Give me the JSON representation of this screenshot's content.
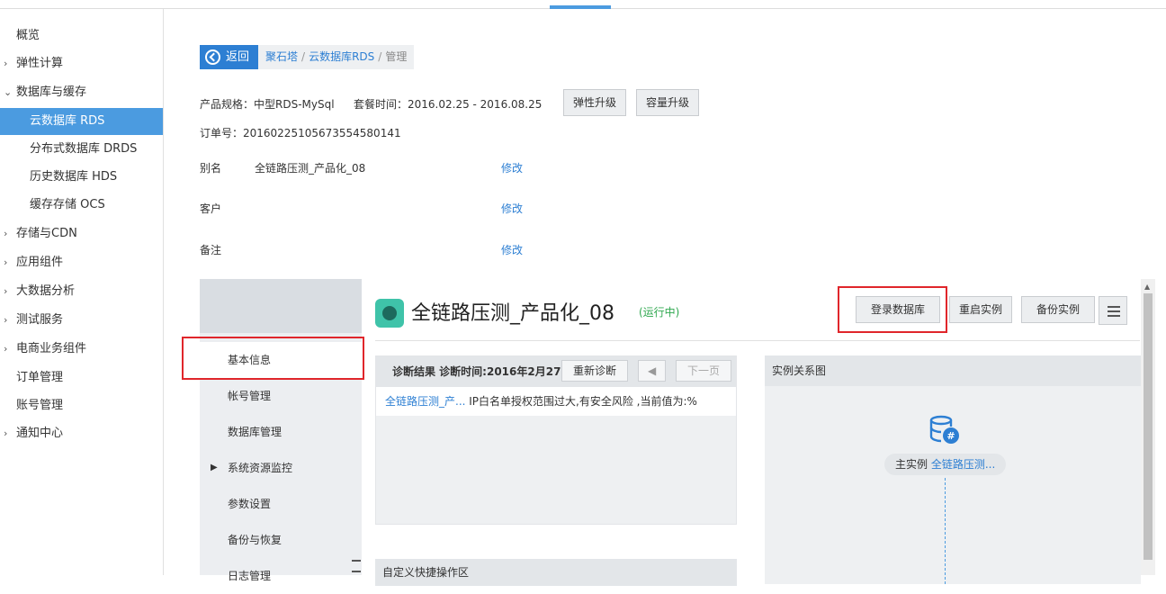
{
  "sidebar": {
    "items": [
      {
        "label": "概览"
      },
      {
        "label": "弹性计算",
        "caret": "›"
      },
      {
        "label": "数据库与缓存",
        "caret": "⌄"
      },
      {
        "label": "云数据库 RDS"
      },
      {
        "label": "分布式数据库 DRDS"
      },
      {
        "label": "历史数据库 HDS"
      },
      {
        "label": "缓存存储 OCS"
      },
      {
        "label": "存储与CDN",
        "caret": "›"
      },
      {
        "label": "应用组件",
        "caret": "›"
      },
      {
        "label": "大数据分析",
        "caret": "›"
      },
      {
        "label": "测试服务",
        "caret": "›"
      },
      {
        "label": "电商业务组件",
        "caret": "›"
      },
      {
        "label": "订单管理"
      },
      {
        "label": "账号管理"
      },
      {
        "label": "通知中心",
        "caret": "›"
      }
    ]
  },
  "breadcrumb": {
    "back_label": "返回",
    "items": [
      "聚石塔",
      "云数据库RDS"
    ],
    "current": "管理"
  },
  "info": {
    "spec": "产品规格：中型RDS-MySql",
    "period": "套餐时间：2016.02.25 - 2016.08.25",
    "upgrade_label": "弹性升级",
    "capacity_label": "容量升级",
    "order": "订单号：20160225105673554580141"
  },
  "fields": {
    "alias_label": "别名",
    "alias_value": "全链路压测_产品化_08",
    "customer_label": "客户",
    "note_label": "备注",
    "edit_label": "修改"
  },
  "subnav": {
    "items": [
      "基本信息",
      "帐号管理",
      "数据库管理",
      "系统资源监控",
      "参数设置",
      "备份与恢复",
      "日志管理"
    ]
  },
  "instance": {
    "title": "全链路压测_产品化_08",
    "status": "(运行中)",
    "login_label": "登录数据库",
    "restart_label": "重启实例",
    "backup_label": "备份实例"
  },
  "diagnosis": {
    "head": "诊断结果 诊断时间:2016年2月27日",
    "rediagnose_label": "重新诊断",
    "next_label": "下一页",
    "row_link": "全链路压测_产...",
    "row_text": " IP白名单授权范围过大,有安全风险 ,当前值为:%"
  },
  "quick": {
    "title": "自定义快捷操作区"
  },
  "relation": {
    "title": "实例关系图",
    "master_label": "主实例",
    "master_link": "全链路压测..."
  }
}
